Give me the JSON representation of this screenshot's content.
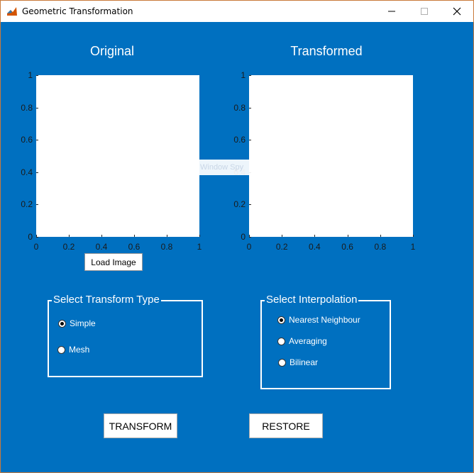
{
  "window": {
    "title": "Geometric Transformation",
    "controls": {
      "minimize": "—",
      "maximize": "□",
      "close": "✕"
    }
  },
  "axes": {
    "original": {
      "title": "Original",
      "yticks": [
        "1",
        "0.8",
        "0.6",
        "0.4",
        "0.2",
        "0"
      ],
      "xticks": [
        "0",
        "0.2",
        "0.4",
        "0.6",
        "0.8",
        "1"
      ]
    },
    "transformed": {
      "title": "Transformed",
      "yticks": [
        "1",
        "0.8",
        "0.6",
        "0.4",
        "0.2",
        "0"
      ],
      "xticks": [
        "0",
        "0.2",
        "0.4",
        "0.6",
        "0.8",
        "1"
      ]
    }
  },
  "load_button": "Load Image",
  "ghost_tooltip": "Window Spy",
  "transform_group": {
    "title": "Select Transform Type",
    "options": [
      {
        "label": "Simple",
        "selected": true
      },
      {
        "label": "Mesh",
        "selected": false
      }
    ]
  },
  "interp_group": {
    "title": "Select Interpolation",
    "options": [
      {
        "label": "Nearest Neighbour",
        "selected": true
      },
      {
        "label": "Averaging",
        "selected": false
      },
      {
        "label": "Bilinear",
        "selected": false
      }
    ]
  },
  "actions": {
    "transform": "TRANSFORM",
    "restore": "RESTORE"
  },
  "colors": {
    "background": "#0070c0",
    "plot_bg": "#ffffff"
  }
}
